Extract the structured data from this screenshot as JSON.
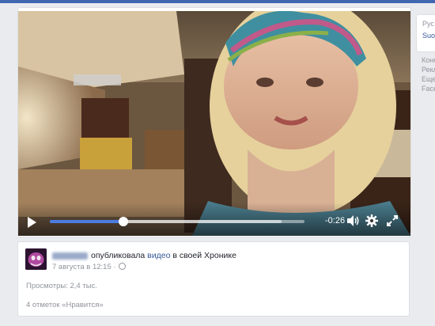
{
  "video": {
    "time_remaining": "-0:26",
    "progress": 0.29,
    "buffered": 0.91,
    "play_icon": "play-icon",
    "volume_icon": "volume-icon",
    "settings_icon": "gear-icon",
    "fullscreen_icon": "fullscreen-icon"
  },
  "post": {
    "action": "опубликовала",
    "video_link": "видео",
    "suffix": "в своей Хронике",
    "date": "7 августа в 12:15 ·",
    "views": "Просмотры: 2,4 тыс.",
    "likes": "4 отметок «Нравится»"
  },
  "sidebar": {
    "language_label": "Рус",
    "language_link": "Suo",
    "links": [
      "Конф",
      "Рекл",
      "Еще",
      "Face"
    ]
  },
  "colors": {
    "accent": "#4267b2",
    "link": "#365899",
    "progress": "#4c7be0",
    "background": "#e9ebee"
  }
}
